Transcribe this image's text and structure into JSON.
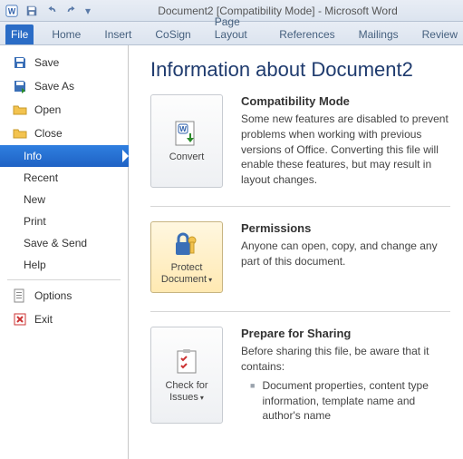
{
  "app": {
    "title": "Document2 [Compatibility Mode] - Microsoft Word"
  },
  "ribbon": {
    "file": "File",
    "tabs": [
      "Home",
      "Insert",
      "CoSign",
      "Page Layout",
      "References",
      "Mailings",
      "Review"
    ]
  },
  "sidebar": {
    "save": "Save",
    "saveas": "Save As",
    "open": "Open",
    "close": "Close",
    "info": "Info",
    "recent": "Recent",
    "new": "New",
    "print": "Print",
    "save_send": "Save & Send",
    "help": "Help",
    "options": "Options",
    "exit": "Exit"
  },
  "content": {
    "heading": "Information about Document2",
    "convert": {
      "btn": "Convert",
      "title": "Compatibility Mode",
      "body": "Some new features are disabled to prevent problems when working with previous versions of Office. Converting this file will enable these features, but may result in layout changes."
    },
    "protect": {
      "btn": "Protect Document",
      "title": "Permissions",
      "body": "Anyone can open, copy, and change any part of this document."
    },
    "check": {
      "btn": "Check for Issues",
      "title": "Prepare for Sharing",
      "body": "Before sharing this file, be aware that it contains:",
      "bullet": "Document properties, content type information, template name and author's name"
    }
  }
}
